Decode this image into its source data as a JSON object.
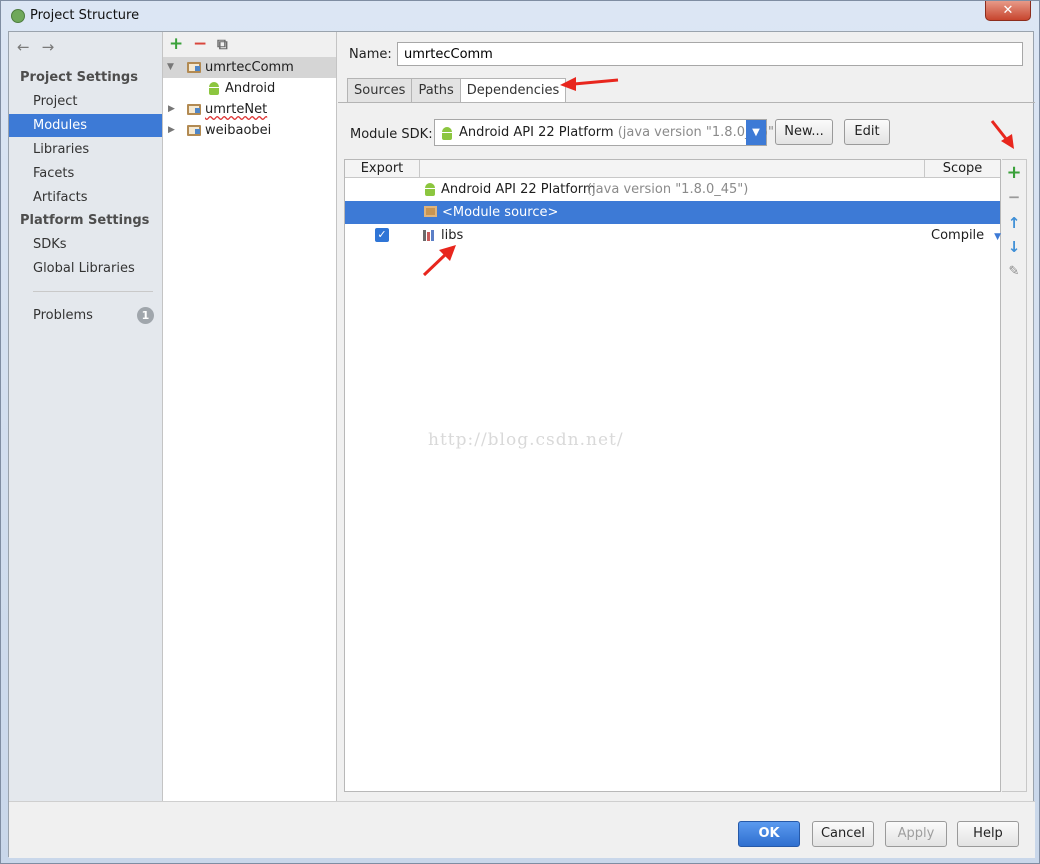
{
  "window": {
    "title": "Project Structure",
    "close_glyph": "✕"
  },
  "nav": {
    "back_icon": "←",
    "forward_icon": "→",
    "project_settings_heading": "Project Settings",
    "platform_settings_heading": "Platform Settings",
    "items": {
      "project": "Project",
      "modules": "Modules",
      "libraries": "Libraries",
      "facets": "Facets",
      "artifacts": "Artifacts",
      "sdks": "SDKs",
      "global_libraries": "Global Libraries",
      "problems": "Problems"
    },
    "problems_count": "1",
    "selected": "modules"
  },
  "tree": {
    "toolbar": {
      "add": "+",
      "remove": "−",
      "copy": "⧉"
    },
    "modules": [
      {
        "label": "umrtecComm",
        "expanded": true,
        "selected": true
      },
      {
        "label": "Android",
        "child": true
      },
      {
        "label": "umrteNet",
        "expanded": false
      },
      {
        "label": "weibaobei",
        "expanded": false
      }
    ]
  },
  "module": {
    "name_label": "Name:",
    "name_value": "umrtecComm",
    "tabs": [
      "Sources",
      "Paths",
      "Dependencies"
    ],
    "active_tab": "Dependencies",
    "sdk_label": "Module SDK:",
    "sdk_value": "Android API 22 Platform",
    "sdk_java": "(java version \"1.8.0_45\")",
    "new_button": "New...",
    "edit_button": "Edit"
  },
  "dependencies": {
    "columns": {
      "export": "Export",
      "scope": "Scope"
    },
    "rows": [
      {
        "name": "Android API 22 Platform",
        "detail": "(java version \"1.8.0_45\")",
        "type": "sdk"
      },
      {
        "name": "<Module source>",
        "type": "source",
        "selected": true
      },
      {
        "name": "libs",
        "type": "library",
        "exported": true,
        "scope": "Compile"
      }
    ],
    "tools": {
      "add": "+",
      "remove": "−",
      "up": "↑",
      "down": "↓",
      "edit": "✎"
    }
  },
  "watermark": "http://blog.csdn.net/",
  "footer": {
    "ok": "OK",
    "cancel": "Cancel",
    "apply": "Apply",
    "help": "Help"
  },
  "colors": {
    "selection": "#3d7ad6",
    "add_green": "#3aa13a",
    "remove_red": "#d9453b",
    "annotation_red": "#e8261d"
  }
}
